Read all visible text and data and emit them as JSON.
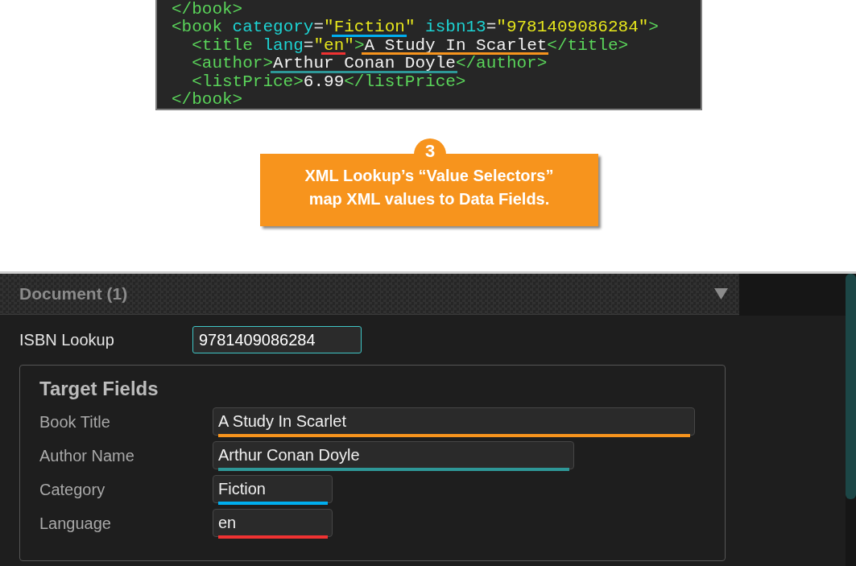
{
  "code": {
    "lines": [
      {
        "tokens": [
          {
            "kind": "tag",
            "text": "</book>"
          }
        ]
      },
      {
        "tokens": [
          {
            "kind": "tag",
            "text": "<book"
          },
          {
            "kind": "attr",
            "text": " category"
          },
          {
            "kind": "punct",
            "text": "="
          },
          {
            "kind": "value",
            "text": "\""
          },
          {
            "kind": "value",
            "text": "Fiction",
            "color": "#00aeef"
          },
          {
            "kind": "value",
            "text": "\""
          },
          {
            "kind": "attr",
            "text": " isbn13"
          },
          {
            "kind": "punct",
            "text": "="
          },
          {
            "kind": "value",
            "text": "\"9781409086284\""
          },
          {
            "kind": "tag",
            "text": ">"
          }
        ],
        "children": [
          {
            "tokens": [
              {
                "kind": "tag",
                "text": "<title"
              },
              {
                "kind": "attr",
                "text": " lang"
              },
              {
                "kind": "punct",
                "text": "="
              },
              {
                "kind": "value",
                "text": "\""
              },
              {
                "kind": "value",
                "text": "en",
                "color": "#f03232"
              },
              {
                "kind": "value",
                "text": "\""
              },
              {
                "kind": "tag",
                "text": ">"
              },
              {
                "kind": "text",
                "text": "A Study In Scarlet",
                "color": "#f7941d"
              },
              {
                "kind": "tag",
                "text": "</title>"
              }
            ]
          },
          {
            "tokens": [
              {
                "kind": "tag",
                "text": "<author>"
              },
              {
                "kind": "text",
                "text": "Arthur Conan Doyle",
                "color": "#2e9797"
              },
              {
                "kind": "tag",
                "text": "</author>"
              }
            ]
          },
          {
            "tokens": [
              {
                "kind": "tag",
                "text": "<listPrice>"
              },
              {
                "kind": "text",
                "text": "6.99"
              },
              {
                "kind": "tag",
                "text": "</listPrice>"
              }
            ]
          }
        ]
      },
      {
        "tokens": [
          {
            "kind": "tag",
            "text": "</book>"
          }
        ]
      }
    ]
  },
  "callout": {
    "step": "3",
    "lines": [
      "XML Lookup’s “Value Selectors”",
      "map XML values to Data Fields."
    ]
  },
  "document_panel": {
    "title": "Document (1)",
    "expanded": true
  },
  "isbn_lookup": {
    "label": "ISBN Lookup",
    "value": "9781409086284",
    "focused": true
  },
  "target_fields": {
    "title": "Target Fields",
    "fields": [
      {
        "label": "Book Title",
        "value": "A Study In Scarlet",
        "color": "#f7941d"
      },
      {
        "label": "Author Name",
        "value": "Arthur Conan Doyle",
        "color": "#2e9797"
      },
      {
        "label": "Category",
        "value": "Fiction",
        "color": "#00aeef"
      },
      {
        "label": "Language",
        "value": "en",
        "color": "#f03232"
      }
    ]
  }
}
